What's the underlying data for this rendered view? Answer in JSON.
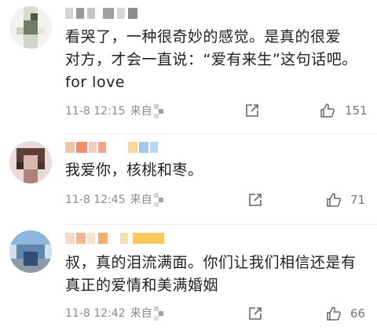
{
  "comments": [
    {
      "text_line1": "看哭了，一种很奇妙的感觉。是真的很爱",
      "text_line2": "对方，才会一直说：“爱有来生”这句话吧。",
      "text_line3": "for love",
      "time": "11-8 12:15",
      "source_label": "来自",
      "likes": "151"
    },
    {
      "text_line1": "我爱你，核桃和枣。",
      "time": "11-8 12:45",
      "source_label": "来自",
      "likes": "71"
    },
    {
      "text_line1": "叔，真的泪流满面。你们让我们相信还是有",
      "text_line2": "真正的爱情和美满婚姻",
      "time": "11-8 12:42",
      "source_label": "来自",
      "likes": "66"
    }
  ],
  "icons": {
    "share": "share-icon",
    "like": "thumbs-up-icon"
  },
  "colors": {
    "text": "#1f1f1f",
    "meta": "#8a8a8a",
    "divider": "#ececec"
  }
}
